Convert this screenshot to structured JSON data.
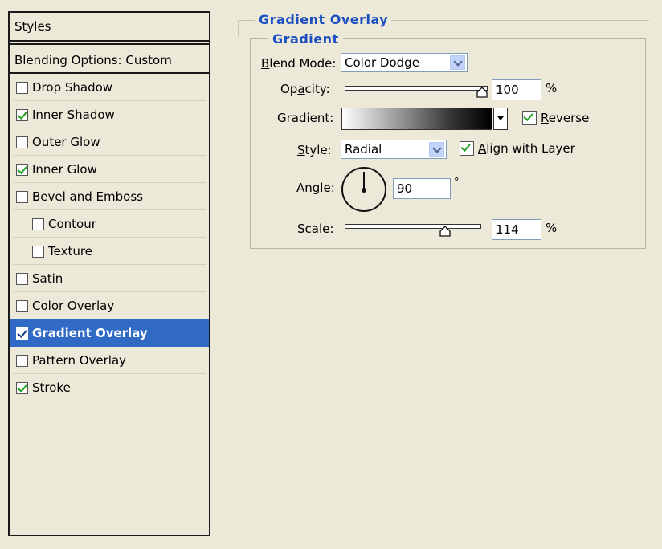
{
  "styles_panel": {
    "header": "Styles",
    "blending_options": "Blending Options: Custom",
    "items": [
      {
        "label": "Drop Shadow",
        "checked": false
      },
      {
        "label": "Inner Shadow",
        "checked": true
      },
      {
        "label": "Outer Glow",
        "checked": false
      },
      {
        "label": "Inner Glow",
        "checked": true
      },
      {
        "label": "Bevel and Emboss",
        "checked": false
      },
      {
        "label": "Contour",
        "checked": false
      },
      {
        "label": "Texture",
        "checked": false
      },
      {
        "label": "Satin",
        "checked": false
      },
      {
        "label": "Color Overlay",
        "checked": false
      },
      {
        "label": "Gradient Overlay",
        "checked": true
      },
      {
        "label": "Pattern Overlay",
        "checked": false
      },
      {
        "label": "Stroke",
        "checked": true
      }
    ]
  },
  "gradient_overlay": {
    "section_title": "Gradient Overlay",
    "group_title": "Gradient",
    "blend_mode": {
      "label": "Blend Mode:",
      "value": "Color Dodge"
    },
    "opacity": {
      "label": "Opacity:",
      "value": "100",
      "unit": "%",
      "level": 1.0
    },
    "gradient": {
      "label": "Gradient:",
      "reverse_label": "Reverse",
      "reverse_checked": true
    },
    "style": {
      "label": "Style:",
      "value": "Radial",
      "align_label": "Align with Layer",
      "align_checked": true
    },
    "angle": {
      "label": "Angle:",
      "value": "90",
      "unit": "°"
    },
    "scale": {
      "label": "Scale:",
      "value": "114",
      "unit": "%",
      "level": 0.7
    }
  },
  "colors": {
    "accent": "#1c4fc0",
    "selection": "#316ac5",
    "background": "#ece9d8",
    "check": "#21a121"
  }
}
